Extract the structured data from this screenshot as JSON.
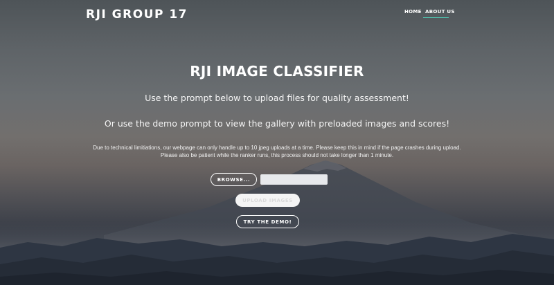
{
  "header": {
    "brand": "RJI GROUP 17",
    "nav": {
      "home": "HOME",
      "about": "ABOUT US"
    }
  },
  "main": {
    "title": "RJI IMAGE CLASSIFIER",
    "lead_1": "Use the prompt below to upload files for quality assessment!",
    "lead_2": "Or use the demo prompt to view the gallery with preloaded images and scores!",
    "notice_1": "Due to technical limitiations, our webpage can only handle up to 10 jpeg uploads at a time. Please keep this in mind if the page crashes during upload.",
    "notice_2": "Please also be patient while the ranker runs, this process should not take longer than 1 minute."
  },
  "form": {
    "browse_label": "BROWSE...",
    "file_value": "",
    "upload_label": "UPLOAD IMAGES",
    "demo_label": "TRY THE DEMO!"
  },
  "colors": {
    "nav_accent": "#4fc9b4",
    "text": "#ffffff"
  }
}
